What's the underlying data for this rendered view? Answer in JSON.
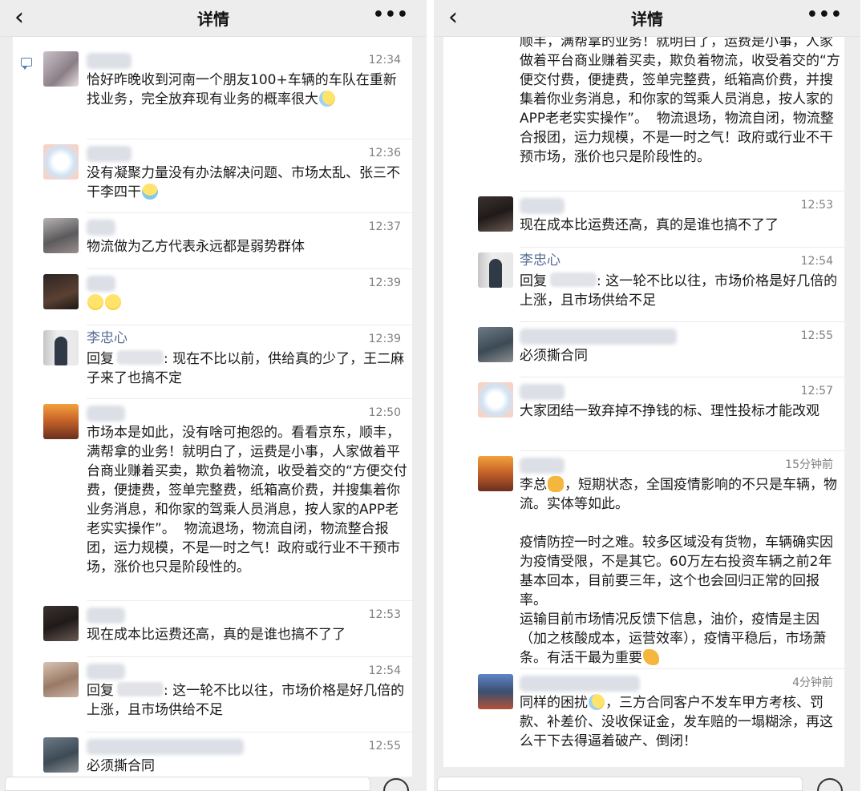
{
  "header": {
    "title": "详情",
    "back_icon": "chevron-left-icon",
    "more_icon": "more-dots-icon"
  },
  "left": {
    "comments": [
      {
        "time": "12:34",
        "text": "恰好昨晚收到河南一个朋友100+车辆的车队在重新找业务，完全放弃现有业务的概率很大",
        "emoji": "sweat"
      },
      {
        "time": "12:36",
        "text": "没有凝聚力量没有办法解决问题、市场太乱、张三不干李四干",
        "emoji": "cry"
      },
      {
        "time": "12:37",
        "text": "物流做为乙方代表永远都是弱势群体"
      },
      {
        "time": "12:39",
        "text": "",
        "emoji": "laugh2"
      },
      {
        "name": "李忠心",
        "time": "12:39",
        "reply_prefix": "回复",
        "text": ": 现在不比以前，供给真的少了，王二麻子来了也搞不定"
      },
      {
        "time": "12:50",
        "text": "市场本是如此，没有啥可抱怨的。看看京东，顺丰，满帮拿的业务！就明白了，运费是小事，人家做着平台商业赚着买卖，欺负着物流，收受着交的“方便交付费，便捷费，签单完整费，纸箱高价费，并搜集着你业务消息，和你家的驾乘人员消息，按人家的APP老老实实操作”。  物流退场，物流自闭，物流整合报团，运力规模，不是一时之气！政府或行业不干预市场，涨价也只是阶段性的。"
      },
      {
        "time": "12:53",
        "text": "现在成本比运费还高，真的是谁也搞不了了"
      },
      {
        "time": "12:54",
        "reply_prefix": "回复",
        "text": ": 这一轮不比以往，市场价格是好几倍的上涨，且市场供给不足"
      },
      {
        "time": "12:55",
        "text": "必须撕合同"
      }
    ]
  },
  "right": {
    "top_text": "顺丰，满帮拿的业务！就明白了，运费是小事，人家做着平台商业赚着买卖，欺负着物流，收受着交的“方便交付费，便捷费，签单完整费，纸箱高价费，并搜集着你业务消息，和你家的驾乘人员消息，按人家的APP老老实实操作”。  物流退场，物流自闭，物流整合报团，运力规模，不是一时之气！政府或行业不干预市场，涨价也只是阶段性的。",
    "comments": [
      {
        "time": "12:53",
        "text": "现在成本比运费还高，真的是谁也搞不了了"
      },
      {
        "name": "李忠心",
        "time": "12:54",
        "reply_prefix": "回复",
        "text": ": 这一轮不比以往，市场价格是好几倍的上涨，且市场供给不足"
      },
      {
        "time": "12:55",
        "text": "必须撕合同"
      },
      {
        "time": "12:57",
        "text": "大家团结一致弃掉不挣钱的标、理性投标才能改观"
      },
      {
        "time": "15分钟前",
        "text_a": "李总",
        "text_b": "，短期状态，全国疫情影响的不只是车辆，物流。实体等如此。\n\n疫情防控一时之难。较多区域没有货物，车辆确实因为疫情受限，不是其它。60万左右投资车辆之前2年基本回本，目前要三年，这个也会回归正常的回报率。\n运输目前市场情况反馈下信息，油价，疫情是主因（加之核酸成本，运营效率），疫情平稳后，市场萧条。有活干最为重要"
      },
      {
        "time": "4分钟前",
        "text_a": "同样的困扰",
        "text_b": "，三方合同客户不发车甲方考核、罚款、补差价、没收保证金，发车赔的一塌糊涂，再这么干下去得逼着破产、倒闭！"
      }
    ]
  },
  "colors": {
    "name": "#576b95",
    "time": "#808080",
    "background": "#ededed",
    "card": "#ffffff"
  }
}
